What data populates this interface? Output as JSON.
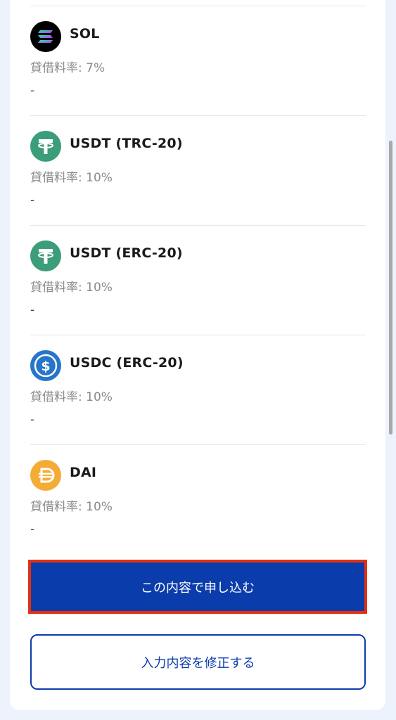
{
  "coins": [
    {
      "name": "SOL",
      "icon": "solana-icon",
      "rate": "貸借料率: 7%",
      "value": "-"
    },
    {
      "name": "USDT (TRC-20)",
      "icon": "tether-icon",
      "rate": "貸借料率: 10%",
      "value": "-"
    },
    {
      "name": "USDT (ERC-20)",
      "icon": "tether-icon",
      "rate": "貸借料率: 10%",
      "value": "-"
    },
    {
      "name": "USDC (ERC-20)",
      "icon": "usdc-icon",
      "rate": "貸借料率: 10%",
      "value": "-"
    },
    {
      "name": "DAI",
      "icon": "dai-icon",
      "rate": "貸借料率: 10%",
      "value": "-"
    }
  ],
  "actions": {
    "submit_label": "この内容で申し込む",
    "edit_label": "入力内容を修正する"
  },
  "colors": {
    "primary": "#0b3cab",
    "highlight": "#e23112",
    "tether": "#3c9d7a",
    "usdc": "#2775ca",
    "dai": "#f5ac37",
    "solana_bg": "#000000"
  }
}
